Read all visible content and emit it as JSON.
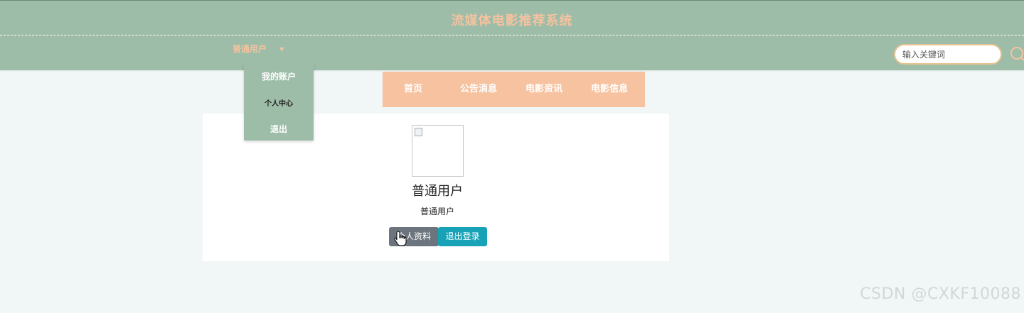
{
  "header": {
    "title": "流媒体电影推荐系统",
    "user_menu_label": "普通用户",
    "search_placeholder": "输入关键词"
  },
  "user_dropdown": {
    "items": [
      {
        "label": "我的账户"
      },
      {
        "label": "个人中心"
      },
      {
        "label": "退出"
      }
    ]
  },
  "nav": {
    "items": [
      {
        "label": "首页"
      },
      {
        "label": "公告消息"
      },
      {
        "label": "电影资讯"
      },
      {
        "label": "电影信息"
      }
    ]
  },
  "profile": {
    "name": "普通用户",
    "role": "普通用户",
    "profile_button": "个人资料",
    "logout_button": "退出登录"
  },
  "watermark": "CSDN @CXKF10088",
  "colors": {
    "header_bg": "#9ebda9",
    "accent_peach": "#f6c29f",
    "page_bg": "#f1f7f6",
    "btn_secondary": "#6c757d",
    "btn_info": "#17a2b8"
  },
  "icons": {
    "search": "search-icon",
    "caret": "caret-down-icon",
    "avatar": "broken-image-icon",
    "cursor": "hand-cursor-icon"
  }
}
